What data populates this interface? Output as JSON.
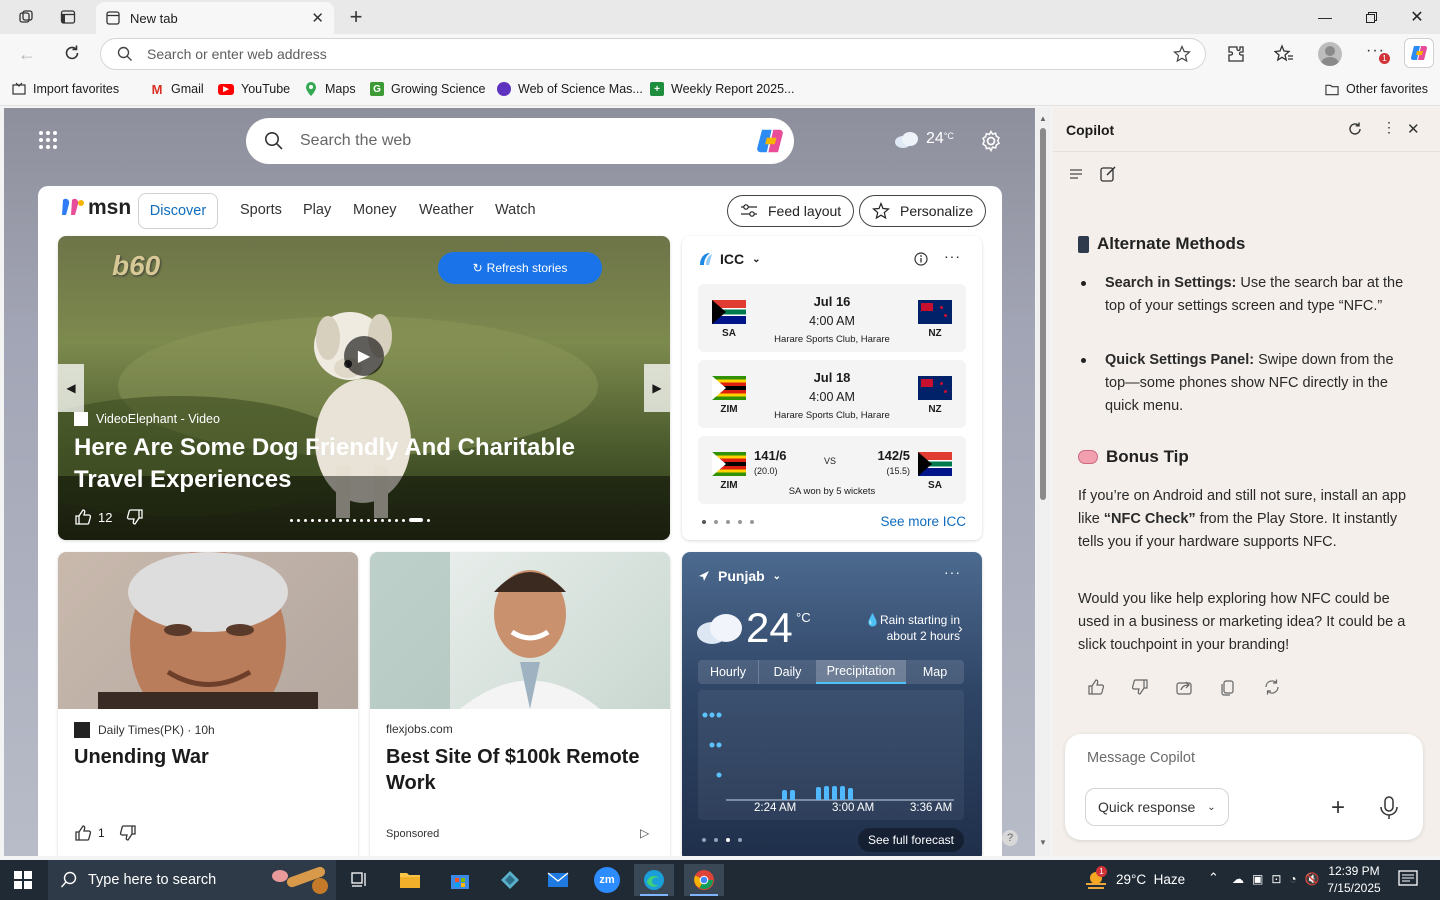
{
  "browser": {
    "tab_title": "New tab",
    "address_placeholder": "Search or enter web address"
  },
  "bookmarks": [
    {
      "label": "Import favorites",
      "icon": "import-icon"
    },
    {
      "label": "Gmail",
      "icon": "gmail-icon"
    },
    {
      "label": "YouTube",
      "icon": "youtube-icon"
    },
    {
      "label": "Maps",
      "icon": "maps-icon"
    },
    {
      "label": "Growing Science",
      "icon": "growing-science-icon"
    },
    {
      "label": "Web of Science Mas...",
      "icon": "web-of-science-icon"
    },
    {
      "label": "Weekly Report 2025...",
      "icon": "sheets-icon"
    }
  ],
  "other_favorites": "Other favorites",
  "newtab": {
    "search_placeholder": "Search the web",
    "temperature": "24",
    "temp_unit": "°C"
  },
  "msn": {
    "logo": "msn",
    "nav": [
      "Discover",
      "Sports",
      "Play",
      "Money",
      "Weather",
      "Watch"
    ],
    "feed_layout": "Feed layout",
    "personalize": "Personalize",
    "hero": {
      "watermark": "b60",
      "refresh": "Refresh stories",
      "source": "VideoElephant - Video",
      "title": "Here Are Some Dog Friendly And Charitable Travel Experiences",
      "likes": "12"
    },
    "cricket": {
      "title": "ICC",
      "matches": [
        {
          "team1": "SA",
          "team2": "NZ",
          "date": "Jul 16",
          "time": "4:00 AM",
          "venue": "Harare Sports Club, Harare"
        },
        {
          "team1": "ZIM",
          "team2": "NZ",
          "date": "Jul 18",
          "time": "4:00 AM",
          "venue": "Harare Sports Club, Harare"
        }
      ],
      "result": {
        "team1": "ZIM",
        "score1": "141/6",
        "overs1": "(20.0)",
        "vs": "VS",
        "team2": "SA",
        "score2": "142/5",
        "overs2": "(15.5)",
        "summary": "SA won by 5 wickets"
      },
      "see_more": "See more ICC"
    },
    "stories": [
      {
        "source": "Daily Times(PK) · 10h",
        "title": "Unending War",
        "likes": "1"
      },
      {
        "source": "flexjobs.com",
        "title": "Best Site Of $100k Remote Work",
        "sponsored": "Sponsored"
      }
    ],
    "weather": {
      "location": "Punjab",
      "temp": "24",
      "unit": "°C",
      "alert": "Rain starting in about 2 hours",
      "tabs": [
        "Hourly",
        "Daily",
        "Precipitation",
        "Map"
      ],
      "times": [
        "2:24 AM",
        "3:00 AM",
        "3:36 AM"
      ],
      "see_full": "See full forecast"
    }
  },
  "copilot": {
    "title": "Copilot",
    "heading1": "Alternate Methods",
    "items": [
      {
        "bold": "Search in Settings:",
        "text": " Use the search bar at the top of your settings screen and type “NFC.”"
      },
      {
        "bold": "Quick Settings Panel:",
        "text": " Swipe down from the top—some phones show NFC directly in the quick menu."
      }
    ],
    "heading2": "Bonus Tip",
    "para1_a": "If you’re on Android and still not sure, install an app like ",
    "para1_b": "“NFC Check”",
    "para1_c": " from the Play Store. It instantly tells you if your hardware supports NFC.",
    "para2": "Would you like help exploring how NFC could be used in a business or marketing idea? It could be a slick touchpoint in your branding!",
    "message_placeholder": "Message Copilot",
    "quick_response": "Quick response"
  },
  "taskbar": {
    "search_placeholder": "Type here to search",
    "weather": "29°C  Haze",
    "time": "12:39 PM",
    "date": "7/15/2025",
    "notif_count": "1"
  }
}
